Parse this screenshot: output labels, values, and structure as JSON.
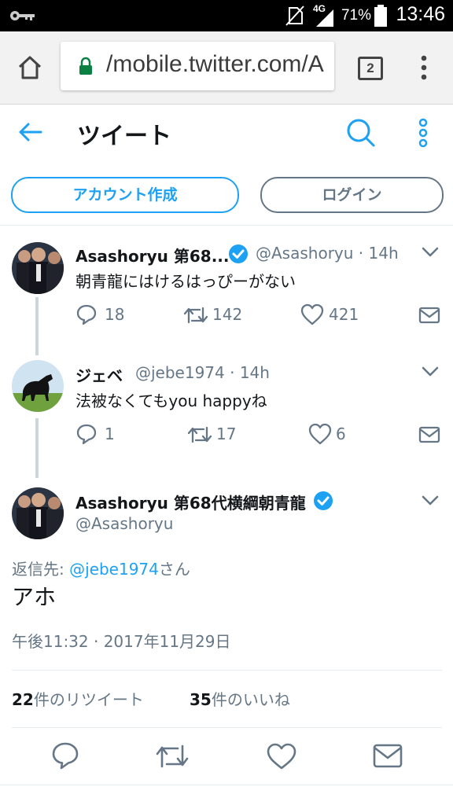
{
  "statusbar": {
    "network": "4G",
    "battery": "71%",
    "time": "13:46"
  },
  "browser": {
    "url": "/mobile.twitter.com/A",
    "tabs": "2"
  },
  "header": {
    "title": "ツイート"
  },
  "buttons": {
    "signup": "アカウント作成",
    "login": "ログイン"
  },
  "tweets": [
    {
      "name": "Asashoryu 第68...",
      "handle": "@Asashoryu · 14h",
      "text": "朝青龍にはけるはっぴーがない",
      "replies": "18",
      "retweets": "142",
      "likes": "421"
    },
    {
      "name": "ジェベ",
      "handle": "@jebe1974 · 14h",
      "text": "法被なくてもyou happyね",
      "replies": "1",
      "retweets": "17",
      "likes": "6"
    }
  ],
  "main_tweet": {
    "name": "Asashoryu 第68代横綱朝青龍",
    "handle": "@Asashoryu",
    "reply_prefix": "返信先: ",
    "reply_to": "@jebe1974",
    "reply_suffix": "さん",
    "text": "アホ",
    "timestamp": "午後11:32 · 2017年11月29日",
    "retweet_count": "22",
    "retweet_label": "件のリツイート",
    "like_count": "35",
    "like_label": "件のいいね"
  },
  "colors": {
    "accent": "#1da1f2",
    "muted": "#657786",
    "verified": "#1da1f2",
    "lock": "#0b8043"
  },
  "icons": [
    "key-icon",
    "home-icon",
    "lock-icon",
    "back-arrow-icon",
    "search-icon",
    "more-icon",
    "verified-icon",
    "reply-icon",
    "retweet-icon",
    "like-icon",
    "dm-icon",
    "chevron-down-icon"
  ]
}
